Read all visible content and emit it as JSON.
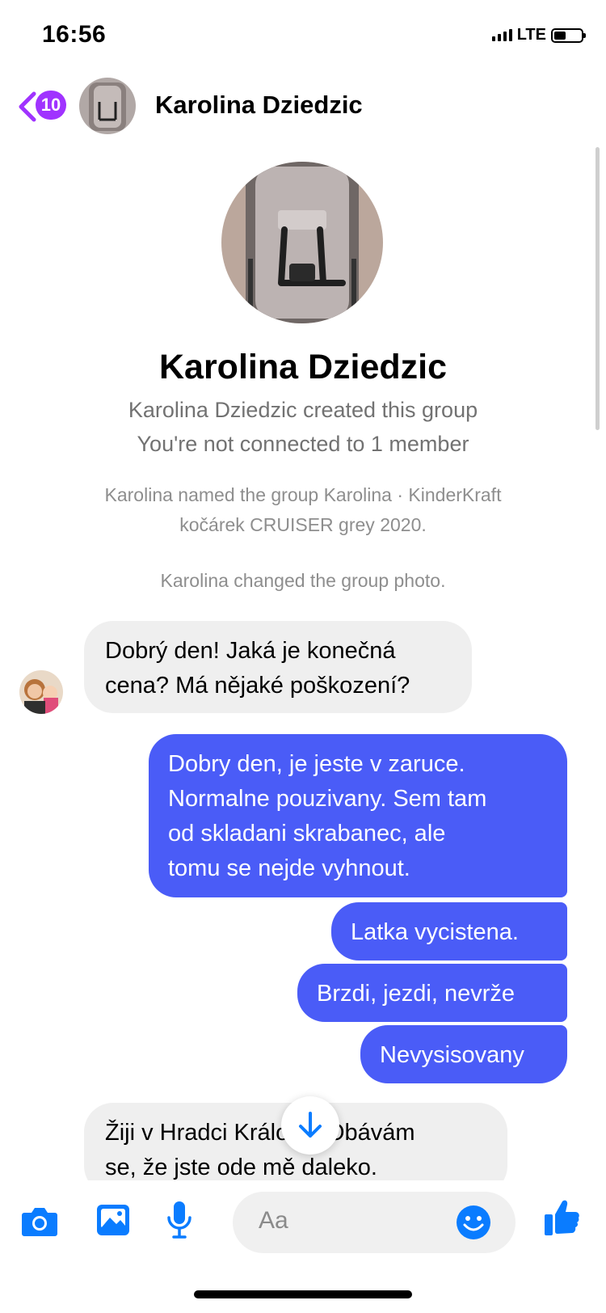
{
  "status_bar": {
    "time": "16:56",
    "network": "LTE"
  },
  "header": {
    "back_count": "10",
    "name": "Karolina Dziedzic"
  },
  "profile": {
    "name": "Karolina Dziedzic",
    "created": "Karolina Dziedzic created this group",
    "connection": "You're not connected to 1 member"
  },
  "system_messages": {
    "named_line1": "Karolina named the group Karolina · KinderKraft",
    "named_line2": "kočárek CRUISER grey 2020.",
    "photo_changed": "Karolina changed the group photo."
  },
  "messages": [
    {
      "from": "them",
      "lines": [
        "Dobrý den! Jaká je konečná",
        "cena? Má nějaké poškození?"
      ]
    },
    {
      "from": "me",
      "lines": [
        "Dobry den, je jeste v zaruce.",
        "Normalne pouzivany. Sem tam",
        "od skladani skrabanec, ale",
        "tomu se nejde vyhnout."
      ]
    },
    {
      "from": "me",
      "lines": [
        "Latka vycistena."
      ]
    },
    {
      "from": "me",
      "lines": [
        "Brzdi, jezdi, nevrže"
      ]
    },
    {
      "from": "me",
      "lines": [
        "Nevysisovany"
      ]
    },
    {
      "from": "them",
      "lines": [
        "Žiji v Hradci Králové. Obávám",
        "se, že jste ode mě daleko."
      ]
    }
  ],
  "composer": {
    "placeholder": "Aa"
  },
  "icons": {
    "camera": "camera-icon",
    "gallery": "image-icon",
    "mic": "microphone-icon",
    "emoji": "emoji-icon",
    "like": "thumbs-up-icon",
    "back": "chevron-left-icon",
    "scroll": "arrow-down-icon"
  },
  "colors": {
    "accent": "#0a7cff",
    "outgoing_bubble": "#4a5cf7",
    "incoming_bubble": "#efefef",
    "badge": "#a033ff"
  }
}
